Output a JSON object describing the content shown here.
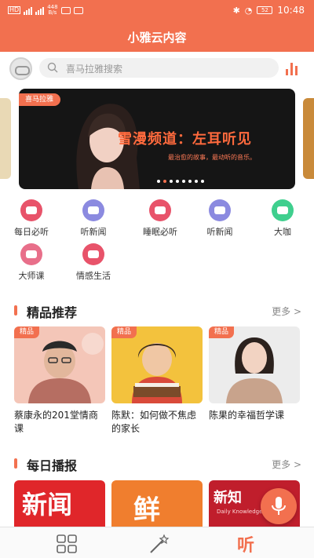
{
  "status_bar": {
    "network_speed": "448\nB/s",
    "battery": "52",
    "time": "10:48"
  },
  "header": {
    "title": "小雅云内容"
  },
  "search": {
    "placeholder": "喜马拉雅搜索"
  },
  "banner": {
    "tag": "喜马拉雅",
    "headline": "雪漫频道：左耳听见",
    "subtitle": "最治愈的故事，最动听的音乐。",
    "page_count": 8,
    "active_page": 1
  },
  "categories": [
    {
      "label": "每日必听",
      "icon": "thumbs-up-icon",
      "color": "#e8536a"
    },
    {
      "label": "听新闻",
      "icon": "news-icon",
      "color": "#8b8ae0"
    },
    {
      "label": "睡眠必听",
      "icon": "thumbs-up-icon",
      "color": "#e8536a"
    },
    {
      "label": "听新闻",
      "icon": "news-icon",
      "color": "#8b8ae0"
    },
    {
      "label": "大咖",
      "icon": "v-badge-icon",
      "color": "#3fcf8e"
    },
    {
      "label": "大师课",
      "icon": "presentation-icon",
      "color": "#e86f8a"
    },
    {
      "label": "情感生活",
      "icon": "hearts-icon",
      "color": "#e8536a"
    }
  ],
  "sections": {
    "featured": {
      "title": "精品推荐",
      "more": "更多 >"
    },
    "daily": {
      "title": "每日播报",
      "more": "更多 >"
    }
  },
  "featured_cards": [
    {
      "badge": "精品",
      "title": "蔡康永的201堂情商课",
      "bg": "#f4c6b8"
    },
    {
      "badge": "精品",
      "title": "陈默：如何做不焦虑的家长",
      "bg": "#f3c23d"
    },
    {
      "badge": "精品",
      "title": "陈果的幸福哲学课",
      "bg": "#ececec"
    }
  ],
  "daily_cards": [
    {
      "text": "新闻",
      "bg": "#e0262a"
    },
    {
      "text": "鲜",
      "bg": "#f07e2e"
    },
    {
      "text": "新知",
      "sub": "Daily Knowledge",
      "bg": "#c01e2c"
    }
  ],
  "bottom_nav": [
    {
      "icon": "grid-icon",
      "active": false
    },
    {
      "icon": "magic-wand-icon",
      "active": false
    },
    {
      "label": "听",
      "icon": "listen-icon",
      "active": true
    }
  ],
  "colors": {
    "accent": "#f2704f",
    "accent_text": "#ff6a3d"
  }
}
